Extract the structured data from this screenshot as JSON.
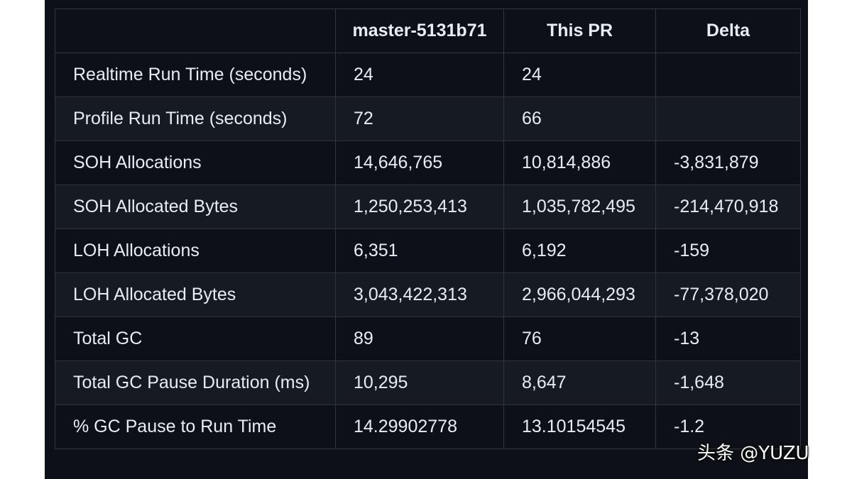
{
  "table": {
    "headers": [
      "",
      "master-5131b71",
      "This PR",
      "Delta"
    ],
    "rows": [
      [
        "Realtime Run Time (seconds)",
        "24",
        "24",
        ""
      ],
      [
        "Profile Run Time (seconds)",
        "72",
        "66",
        ""
      ],
      [
        "SOH Allocations",
        "14,646,765",
        "10,814,886",
        "-3,831,879"
      ],
      [
        "SOH Allocated Bytes",
        "1,250,253,413",
        "1,035,782,495",
        "-214,470,918"
      ],
      [
        "LOH Allocations",
        "6,351",
        "6,192",
        "-159"
      ],
      [
        "LOH Allocated Bytes",
        "3,043,422,313",
        "2,966,044,293",
        "-77,378,020"
      ],
      [
        "Total GC",
        "89",
        "76",
        "-13"
      ],
      [
        "Total GC Pause Duration (ms)",
        "10,295",
        "8,647",
        "-1,648"
      ],
      [
        "% GC Pause to Run Time",
        "14.29902778",
        "13.10154545",
        "-1.2"
      ]
    ]
  },
  "watermark": "头条 @YUZU",
  "colors": {
    "background": "#0d1117",
    "row_alt": "#161b22",
    "border": "#30363d",
    "text": "#e6edf3"
  }
}
